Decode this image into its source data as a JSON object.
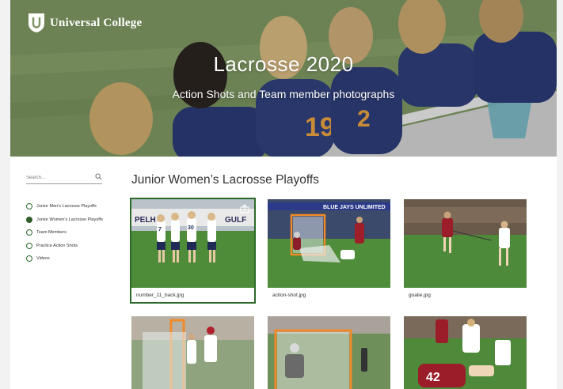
{
  "brand": {
    "name": "Universal College",
    "logo_icon": "shield-logo-icon"
  },
  "hero": {
    "title": "Lacrosse 2020",
    "subtitle": "Action Shots and Team member photographs"
  },
  "sidebar": {
    "search_placeholder": "Search...",
    "filters": [
      {
        "label": "Junior Men's Lacrosse Playoffs",
        "selected": false
      },
      {
        "label": "Junior Women's Lacrosse Playoffs",
        "selected": true
      },
      {
        "label": "Team Members",
        "selected": false
      },
      {
        "label": "Practice Action Shots",
        "selected": false
      },
      {
        "label": "Videos",
        "selected": false
      }
    ]
  },
  "main": {
    "title": "Junior Women’s Lacrosse Playoffs",
    "photos": [
      {
        "filename": "number_11_back.jpg",
        "selected": true
      },
      {
        "filename": "action-shot.jpg",
        "selected": false
      },
      {
        "filename": "goalie.jpg",
        "selected": false
      },
      {
        "filename": "",
        "selected": false
      },
      {
        "filename": "",
        "selected": false
      },
      {
        "filename": "",
        "selected": false
      }
    ]
  },
  "colors": {
    "accent": "#2c6a2a",
    "hero_text": "#ffffff"
  }
}
